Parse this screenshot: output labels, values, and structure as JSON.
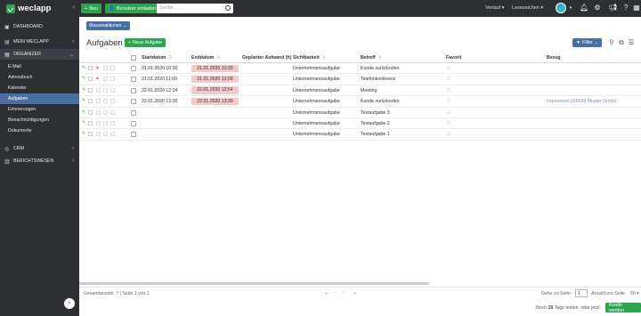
{
  "app": {
    "logo_text": "weclapp",
    "new_label": "Neu",
    "invite_label": "Benutzer einladen",
    "search_placeholder": "Suche...",
    "history_label": "Verlauf",
    "bookmarks_label": "Lesezeichen"
  },
  "sidebar": {
    "items": [
      {
        "label": "DASHBOARD"
      },
      {
        "label": "MEIN WECLAPP"
      },
      {
        "label": "ORGANIZER"
      },
      {
        "label": "E-Mail"
      },
      {
        "label": "Adressbuch"
      },
      {
        "label": "Kalender"
      },
      {
        "label": "Aufgaben"
      },
      {
        "label": "Erinnerungen"
      },
      {
        "label": "Benachrichtigungen"
      },
      {
        "label": "Dokumente"
      },
      {
        "label": "CRM"
      },
      {
        "label": "BERICHTSWESEN"
      }
    ]
  },
  "toolbar": {
    "mass_actions_label": "Massenaktionen",
    "page_title": "Aufgaben",
    "new_task_label": "Neue Aufgabe",
    "filter_label": "Filter"
  },
  "table": {
    "columns": {
      "start": "Startdatum",
      "end": "Enddatum",
      "effort": "Geplanter Aufwand (h)",
      "visibility": "Sichtbarkeit",
      "subject": "Betreff",
      "favorite": "Favorit",
      "reference": "Bezug"
    },
    "rows": [
      {
        "start": "21.01.2020 10:00",
        "end": "21.01.2020 10:30",
        "visibility": "Unternehmensaufgabe",
        "subject": "Kunde zurückrufen",
        "reference": ""
      },
      {
        "start": "21.01.2020 11:00",
        "end": "21.01.2020 12:00",
        "visibility": "Unternehmensaufgabe",
        "subject": "Telefonkonferenz",
        "reference": ""
      },
      {
        "start": "22.01.2020 12:24",
        "end": "22.01.2020 12:54",
        "visibility": "Unternehmensaufgabe",
        "subject": "Meeting",
        "reference": ""
      },
      {
        "start": "22.01.2020 13:00",
        "end": "22.01.2020 13:30",
        "visibility": "Unternehmensaufgabe",
        "subject": "Kunde zurückrufen",
        "reference": "Interessent [10006] Muster GmbH"
      },
      {
        "start": "",
        "end": "",
        "visibility": "Unternehmensaufgabe",
        "subject": "Testaufgabe 3",
        "reference": ""
      },
      {
        "start": "",
        "end": "",
        "visibility": "Unternehmensaufgabe",
        "subject": "Testaufgabe 2",
        "reference": ""
      },
      {
        "start": "",
        "end": "",
        "visibility": "Unternehmensaufgabe",
        "subject": "Testaufgabe 1",
        "reference": ""
      }
    ]
  },
  "footer": {
    "summary": "Gesamtanzahl: 7 | Seite 1 von 1",
    "goto_label": "Gehe zu Seite:",
    "page_value": "1",
    "per_page_label": "Anzahl pro Seite",
    "per_page_value": "50",
    "trial_prefix": "Noch",
    "trial_days": "28",
    "trial_suffix": "Tage testen, oder jetzt",
    "trial_button": "Kunde werden"
  },
  "colors": {
    "sidebar_bg": "#2d2f33",
    "accent_green": "#2ea44f",
    "accent_blue": "#4a6fa5",
    "enddate_bg": "#f4c9c9"
  }
}
